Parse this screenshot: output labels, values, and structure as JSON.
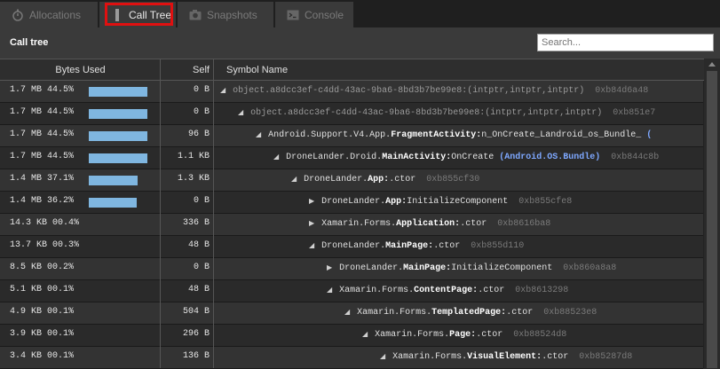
{
  "tabs": [
    {
      "label": "Allocations",
      "icon": "stopwatch-icon",
      "active": false
    },
    {
      "label": "Call Tree",
      "icon": "tree-icon",
      "active": true
    },
    {
      "label": "Snapshots",
      "icon": "camera-icon",
      "active": false
    },
    {
      "label": "Console",
      "icon": "console-icon",
      "active": false
    }
  ],
  "panel": {
    "title": "Call tree"
  },
  "search": {
    "placeholder": "Search..."
  },
  "columns": {
    "bytes": "Bytes Used",
    "self": "Self",
    "symbol": "Symbol Name"
  },
  "rows": [
    {
      "bytes": "1.7 MB 44.5%",
      "bar": 0.445,
      "self": "0 B",
      "expanded": true,
      "parts": [
        "object.a8dcc3ef-c4dd-43ac-9ba6-8bd3b7be99e8:(intptr,intptr,intptr)"
      ],
      "addr": "0xb84d6a48",
      "dim": true
    },
    {
      "bytes": "1.7 MB 44.5%",
      "bar": 0.445,
      "self": "0 B",
      "expanded": true,
      "parts": [
        "object.a8dcc3ef-c4dd-43ac-9ba6-8bd3b7be99e8:(intptr,intptr,intptr)"
      ],
      "addr": "0xb851e7",
      "dim": true
    },
    {
      "bytes": "1.7 MB 44.5%",
      "bar": 0.445,
      "self": "96 B",
      "expanded": true,
      "pre": "Android.Support.V4.App.",
      "bold": "FragmentActivity:",
      "post": "n_OnCreate_Landroid_os_Bundle_",
      "extra": "(",
      "addr": ""
    },
    {
      "bytes": "1.7 MB 44.5%",
      "bar": 0.445,
      "self": "1.1 KB",
      "expanded": true,
      "pre": "DroneLander.Droid.",
      "bold": "MainActivity:",
      "post": "OnCreate",
      "blue": "(Android.OS.Bundle)",
      "addr": "0xb844c8b"
    },
    {
      "bytes": "1.4 MB 37.1%",
      "bar": 0.371,
      "self": "1.3 KB",
      "expanded": true,
      "pre": "DroneLander.",
      "bold": "App:",
      "post": ".ctor",
      "addr": "0xb855cf30"
    },
    {
      "bytes": "1.4 MB 36.2%",
      "bar": 0.362,
      "self": "0 B",
      "expanded": false,
      "pre": "DroneLander.",
      "bold": "App:",
      "post": "InitializeComponent",
      "addr": "0xb855cfe8"
    },
    {
      "bytes": "14.3 KB 00.4%",
      "bar": 0,
      "self": "336 B",
      "expanded": false,
      "pre": "Xamarin.Forms.",
      "bold": "Application:",
      "post": ".ctor",
      "addr": "0xb8616ba8"
    },
    {
      "bytes": "13.7 KB 00.3%",
      "bar": 0,
      "self": "48 B",
      "expanded": true,
      "pre": "DroneLander.",
      "bold": "MainPage:",
      "post": ".ctor",
      "addr": "0xb855d110"
    },
    {
      "bytes": "8.5 KB 00.2%",
      "bar": 0,
      "self": "0 B",
      "expanded": false,
      "pre": "DroneLander.",
      "bold": "MainPage:",
      "post": "InitializeComponent",
      "addr": "0xb860a8a8"
    },
    {
      "bytes": "5.1 KB 00.1%",
      "bar": 0,
      "self": "48 B",
      "expanded": true,
      "pre": "Xamarin.Forms.",
      "bold": "ContentPage:",
      "post": ".ctor",
      "addr": "0xb8613298"
    },
    {
      "bytes": "4.9 KB 00.1%",
      "bar": 0,
      "self": "504 B",
      "expanded": true,
      "pre": "Xamarin.Forms.",
      "bold": "TemplatedPage:",
      "post": ".ctor",
      "addr": "0xb88523e8"
    },
    {
      "bytes": "3.9 KB 00.1%",
      "bar": 0,
      "self": "296 B",
      "expanded": true,
      "pre": "Xamarin.Forms.",
      "bold": "Page:",
      "post": ".ctor",
      "addr": "0xb88524d8"
    },
    {
      "bytes": "3.4 KB 00.1%",
      "bar": 0,
      "self": "136 B",
      "expanded": true,
      "pre": "Xamarin.Forms.",
      "bold": "VisualElement:",
      "post": ".ctor",
      "addr": "0xb85287d8"
    }
  ],
  "colors": {
    "bar": "#7fb6e0",
    "highlight": "#e01010",
    "accent_blue": "#7ea8ff"
  }
}
